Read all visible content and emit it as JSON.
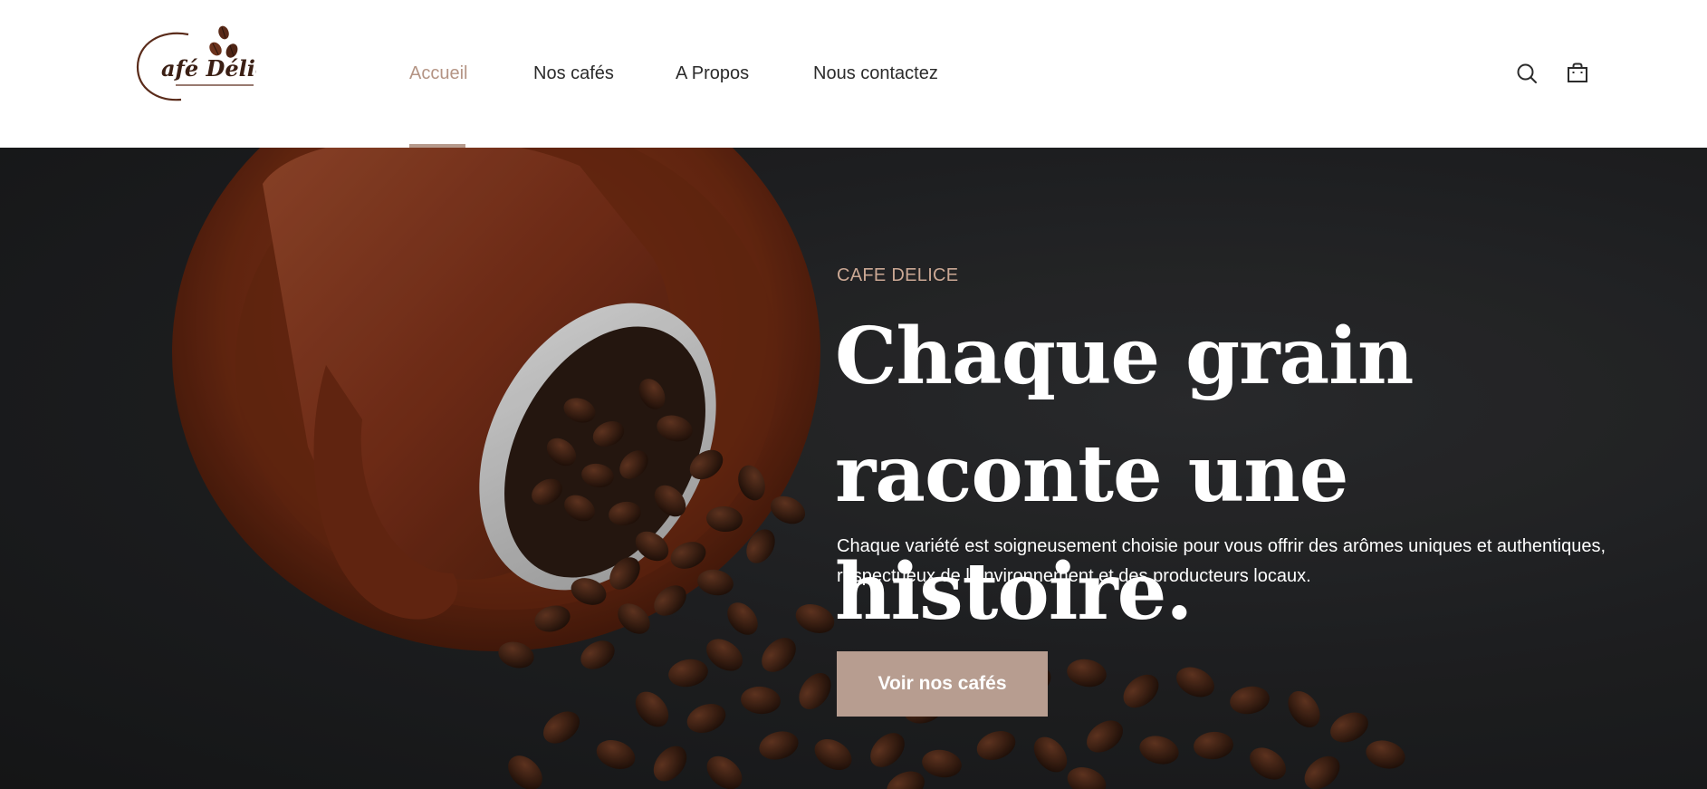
{
  "brand": {
    "logo_text": "afé Délice"
  },
  "nav": {
    "items": [
      {
        "label": "Accueil",
        "active": true
      },
      {
        "label": "Nos cafés",
        "active": false
      },
      {
        "label": "A Propos",
        "active": false
      },
      {
        "label": "Nous contactez",
        "active": false
      }
    ]
  },
  "header_icons": [
    "search-icon",
    "shopping-bag-icon"
  ],
  "hero": {
    "eyebrow": "CAFE DELICE",
    "title": "Chaque grain raconte une histoire.",
    "description": "Chaque variété est soigneusement choisie pour vous offrir des arômes uniques et authentiques, respectueux de l’environnement et des producteurs locaux.",
    "cta_label": "Voir nos cafés"
  },
  "colors": {
    "accent": "#b69a8c",
    "nav_active": "#b49484",
    "eyebrow": "#cba894",
    "hero_background": "#202123",
    "cup": "#7a2f17"
  }
}
